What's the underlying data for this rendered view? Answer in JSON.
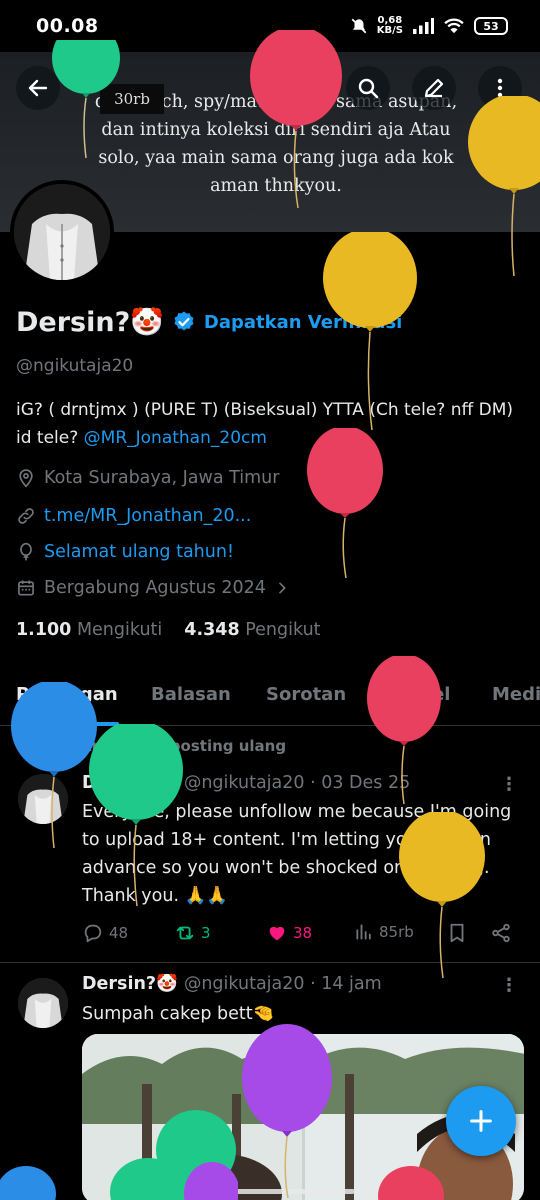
{
  "status_bar": {
    "time": "00.08",
    "net_speed_value": "0,68",
    "net_speed_unit": "KB/S",
    "battery": "53"
  },
  "banner": {
    "tag": "30rb",
    "text": "dapet 3ch, spy/mata-mata, sama asupan, dan intinya koleksi diri sendiri aja Atau solo, yaa main sama orang juga ada kok aman thnkyou."
  },
  "header_buttons": {
    "back_icon": "arrow-left-icon",
    "search_icon": "search-icon",
    "edit_icon": "pencil-icon",
    "more_icon": "more-vertical-icon"
  },
  "profile": {
    "name": "Dersin?🤡",
    "verify_cta": "Dapatkan Verifikasi",
    "handle": "@ngikutaja20",
    "bio_text": "iG? ( drntjmx ) (PURE T) (Biseksual) YTTA (Ch tele? nff DM) id tele? ",
    "bio_mention": "@MR_Jonathan_20cm",
    "location": "Kota Surabaya, Jawa Timur",
    "website": "t.me/MR_Jonathan_20...",
    "birthday": "Selamat ulang tahun!",
    "joined": "Bergabung Agustus 2024",
    "following_count": "1.100",
    "following_label": "Mengikuti",
    "followers_count": "4.348",
    "followers_label": "Pengikut"
  },
  "tabs": [
    "Postingan",
    "Balasan",
    "Sorotan",
    "Artikel",
    "Media"
  ],
  "posts": [
    {
      "repost_note": "Anda memposting ulang",
      "name": "Dersin?🤡",
      "handle_time": "@ngikutaja20 · 03 Des 25",
      "text": "Everyone, please unfollow me because I'm going to upload 18+ content. I'm letting you know in advance so you won't be shocked or anything. Thank you. 🙏🙏",
      "replies": "48",
      "reposts": "3",
      "likes": "38",
      "views": "85rb",
      "repost_color": "#00ba7c",
      "like_color": "#f91880"
    },
    {
      "name": "Dersin?🤡",
      "handle_time": "@ngikutaja20 · 14 jam",
      "text": "Sumpah cakep bett🤏"
    }
  ],
  "colors": {
    "accent": "#1d9bf0",
    "background": "#000000",
    "muted_text": "#71767b"
  },
  "balloon_colors": [
    "#1fc98a",
    "#e8405e",
    "#e8b923",
    "#2b8de6",
    "#a64be8"
  ]
}
